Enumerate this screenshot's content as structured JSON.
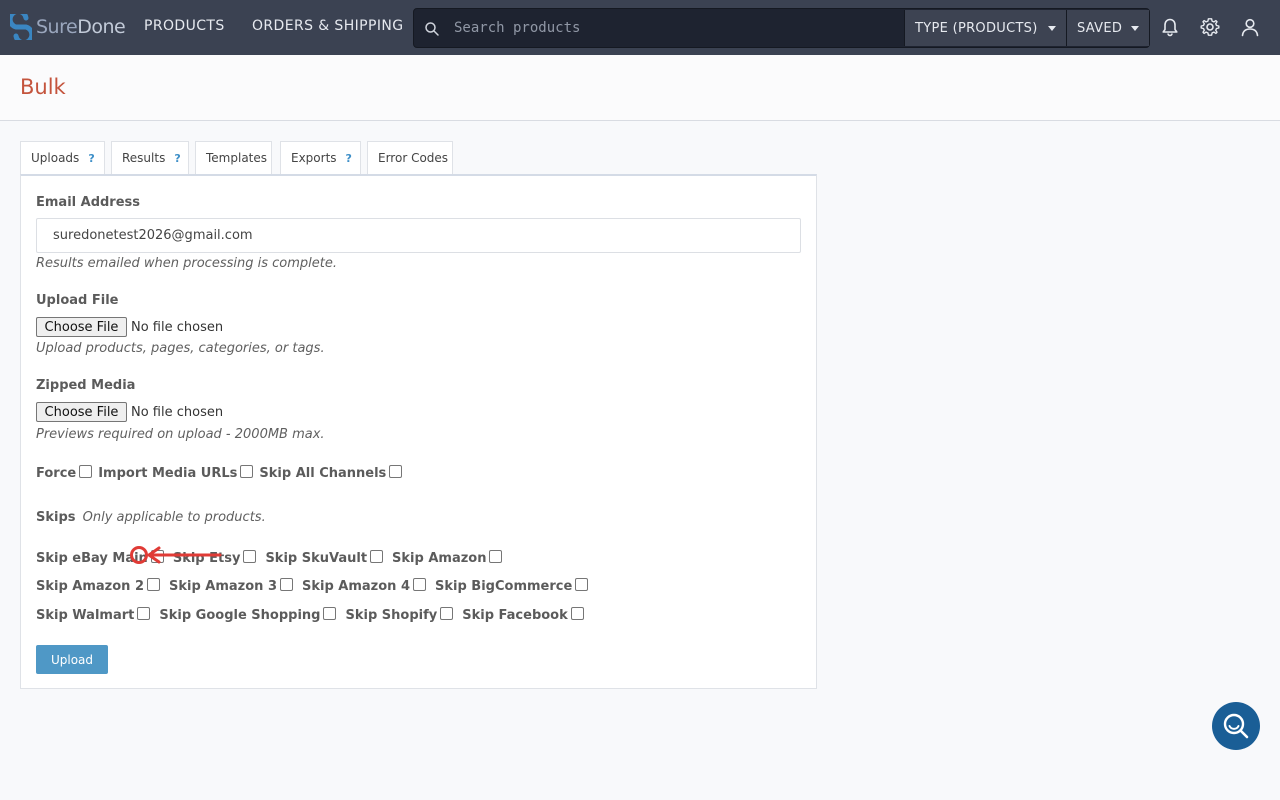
{
  "brand": {
    "logo_part1": "Sure",
    "logo_part2": "Done"
  },
  "nav": {
    "products": "PRODUCTS",
    "orders_shipping": "ORDERS & SHIPPING"
  },
  "search": {
    "placeholder": "Search products",
    "value": "",
    "type_dropdown": "TYPE (PRODUCTS)",
    "saved_dropdown": "SAVED"
  },
  "header": {
    "title": "Bulk"
  },
  "tabs": [
    {
      "label": "Uploads",
      "help": "?"
    },
    {
      "label": "Results",
      "help": "?"
    },
    {
      "label": "Templates"
    },
    {
      "label": "Exports",
      "help": "?"
    },
    {
      "label": "Error Codes"
    }
  ],
  "form": {
    "email": {
      "label": "Email Address",
      "value": "suredonetest2026@gmail.com",
      "help": "Results emailed when processing is complete."
    },
    "upload_file": {
      "label": "Upload File",
      "button": "Choose File",
      "status": "No file chosen",
      "help": "Upload products, pages, categories, or tags."
    },
    "zipped_media": {
      "label": "Zipped Media",
      "button": "Choose File",
      "status": "No file chosen",
      "help": "Previews required on upload - 2000MB max."
    },
    "options": {
      "force": "Force",
      "import_media_urls": "Import Media URLs",
      "skip_all_channels": "Skip All Channels"
    },
    "skips": {
      "label": "Skips",
      "help": "Only applicable to products."
    },
    "skip_channels": [
      [
        "Skip eBay Main",
        "Skip Etsy",
        "Skip SkuVault",
        "Skip Amazon"
      ],
      [
        "Skip Amazon 2",
        "Skip Amazon 3",
        "Skip Amazon 4",
        "Skip BigCommerce"
      ],
      [
        "Skip Walmart",
        "Skip Google Shopping",
        "Skip Shopify",
        "Skip Facebook"
      ]
    ],
    "upload_button": "Upload"
  },
  "colors": {
    "nav_bg": "#3b4252",
    "title": "#c4543d",
    "primary_button": "#4f98c6",
    "annotation": "#e03b36",
    "chat_bubble": "#1a5e96"
  },
  "icons": [
    "search-icon",
    "bell-icon",
    "gear-icon",
    "user-icon",
    "chat-search-icon"
  ]
}
